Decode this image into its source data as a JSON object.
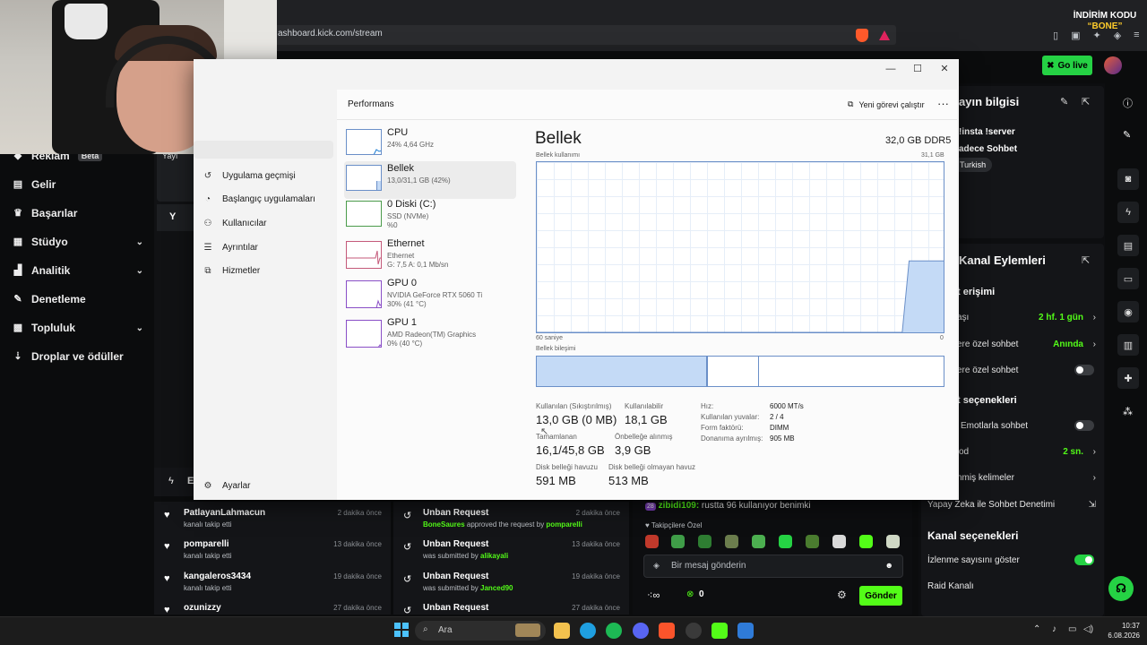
{
  "browser": {
    "address": "ashboard.kick.com/stream",
    "promo_line1": "İNDİRİM KODU",
    "promo_line2": "“BONE”"
  },
  "kick": {
    "go_live": "Go live",
    "sidebar": [
      {
        "label": "Reklam",
        "badge": "Beta",
        "icon": "megaphone-icon"
      },
      {
        "label": "Gelir",
        "icon": "chart-icon"
      },
      {
        "label": "Başarılar",
        "icon": "trophy-icon"
      },
      {
        "label": "Stüdyo",
        "icon": "studio-icon",
        "chevron": true
      },
      {
        "label": "Analitik",
        "icon": "analytics-icon",
        "chevron": true
      },
      {
        "label": "Denetleme",
        "icon": "wrench-icon"
      },
      {
        "label": "Topluluk",
        "icon": "community-icon",
        "chevron": true
      },
      {
        "label": "Droplar ve ödüller",
        "icon": "drops-icon"
      }
    ],
    "center_frag1": "Yayı",
    "center_frag2": "Y",
    "bottom_frag": "E",
    "right": {
      "stream_info_title": "ayın bilgisi",
      "tags_line1": "!insta !server",
      "tags_line2": "adece Sohbet",
      "tag_lang": "Turkish",
      "channel_actions_title": "Kanal Eylemleri",
      "access_title": "t erişimi",
      "rows": [
        {
          "label": "aşı",
          "value": "2 hf. 1 gün",
          "arrow": true
        },
        {
          "label": "ere özel sohbet",
          "value": "Anında",
          "arrow": true
        },
        {
          "label": "ere özel sohbet",
          "toggle": false
        }
      ],
      "options_title": "t seçenekleri",
      "rows2": [
        {
          "label": "Emotlarla sohbet",
          "toggle": false
        },
        {
          "label": "od",
          "value": "2 sn.",
          "arrow": true
        },
        {
          "label": "nmiş kelimeler",
          "arrow": true
        }
      ],
      "ai_moderation": "Yapay Zeka ile Sohbet Denetimi",
      "channel_options_title": "Kanal seçenekleri",
      "show_viewers": "İzlenme sayısını göster",
      "show_viewers_on": true,
      "raid": "Raid Kanalı"
    },
    "follows": [
      {
        "name": "PatlayanLahmacun",
        "sub": "kanalı takip etti",
        "time": "2 dakika önce"
      },
      {
        "name": "pomparelli",
        "sub": "kanalı takip etti",
        "time": "13 dakika önce"
      },
      {
        "name": "kangaleros3434",
        "sub": "kanalı takip etti",
        "time": "19 dakika önce"
      },
      {
        "name": "ozunizzy",
        "sub": "",
        "time": "27 dakika önce"
      }
    ],
    "requests": [
      {
        "name": "Unban Request",
        "pre": "",
        "user": "BoneSaures",
        "mid": " approved the request by ",
        "user2": "pomparelli",
        "time": "2 dakika önce"
      },
      {
        "name": "Unban Request",
        "pre": "was submitted by ",
        "user": "alikayali",
        "mid": "",
        "user2": "",
        "time": "13 dakika önce"
      },
      {
        "name": "Unban Request",
        "pre": "was submitted by ",
        "user": "Janced90",
        "mid": "",
        "user2": "",
        "time": "19 dakika önce"
      },
      {
        "name": "Unban Request",
        "pre": "",
        "user": "",
        "mid": "",
        "user2": "",
        "time": "27 dakika önce"
      }
    ],
    "chat": {
      "badge": "28",
      "user": "zibidi109:",
      "message": " rustta 96 kullanıyor benimki",
      "followers_only": "Takipçilere Özel",
      "placeholder": "Bir mesaj gönderin",
      "send": "Gönder",
      "count": "0"
    }
  },
  "taskmgr": {
    "nav": [
      "Uygulama geçmişi",
      "Başlangıç uygulamaları",
      "Kullanıcılar",
      "Ayrıntılar",
      "Hizmetler"
    ],
    "settings": "Ayarlar",
    "section_title": "Performans",
    "new_task": "Yeni görevi çalıştır",
    "resources": [
      {
        "name": "CPU",
        "d1": "24%  4,64 GHz",
        "d2": ""
      },
      {
        "name": "Bellek",
        "d1": "13,0/31,1 GB (42%)",
        "d2": ""
      },
      {
        "name": "0 Diski (C:)",
        "d1": "SSD (NVMe)",
        "d2": "%0"
      },
      {
        "name": "Ethernet",
        "d1": "Ethernet",
        "d2": "G: 7,5  A: 0,1 Mb/sn"
      },
      {
        "name": "GPU 0",
        "d1": "NVIDIA GeForce RTX 5060 Ti",
        "d2": "30% (41 °C)"
      },
      {
        "name": "GPU 1",
        "d1": "AMD Radeon(TM) Graphics",
        "d2": "0% (40 °C)"
      }
    ],
    "memory": {
      "title": "Bellek",
      "total": "32,0 GB DDR5",
      "usage_label": "Bellek kullanımı",
      "usage_max": "31,1 GB",
      "time_label": "60 saniye",
      "zero": "0",
      "composition_label": "Bellek bileşimi",
      "in_use_fraction": 0.42,
      "available_sep_fraction": 0.545,
      "usage_history": [
        0,
        0,
        0,
        0,
        0,
        0,
        0,
        0,
        0,
        0,
        0,
        0,
        0,
        0,
        0,
        0,
        0,
        0,
        0,
        0,
        0,
        0,
        0,
        0,
        0,
        0,
        0,
        0,
        0,
        0,
        0,
        0,
        0,
        0,
        0,
        0,
        0,
        0,
        0,
        0,
        0,
        0,
        0,
        0,
        0,
        0,
        0,
        0,
        0,
        0,
        0,
        0,
        0,
        0,
        0.42,
        0.42,
        0.42,
        0.42,
        0.42,
        0.42
      ],
      "stats": [
        {
          "label": "Kullanılan (Sıkıştırılmış)",
          "value": "13,0 GB (0 MB)"
        },
        {
          "label": "Kullanılabilir",
          "value": "18,1 GB"
        },
        {
          "label": "Tamamlanan",
          "value": "16,1/45,8 GB"
        },
        {
          "label": "Önbelleğe alınmış",
          "value": "3,9 GB"
        },
        {
          "label": "Disk belleği havuzu",
          "value": "591 MB"
        },
        {
          "label": "Disk belleği olmayan havuz",
          "value": "513 MB"
        }
      ],
      "details": [
        {
          "k": "Hız:",
          "v": "6000 MT/s"
        },
        {
          "k": "Kullanılan yuvalar:",
          "v": "2 / 4"
        },
        {
          "k": "Form faktörü:",
          "v": "DIMM"
        },
        {
          "k": "Donanıma ayrılmış:",
          "v": "905 MB"
        }
      ]
    }
  },
  "taskbar": {
    "search_placeholder": "Ara",
    "time": "10:37",
    "date": "6.08.2026"
  }
}
